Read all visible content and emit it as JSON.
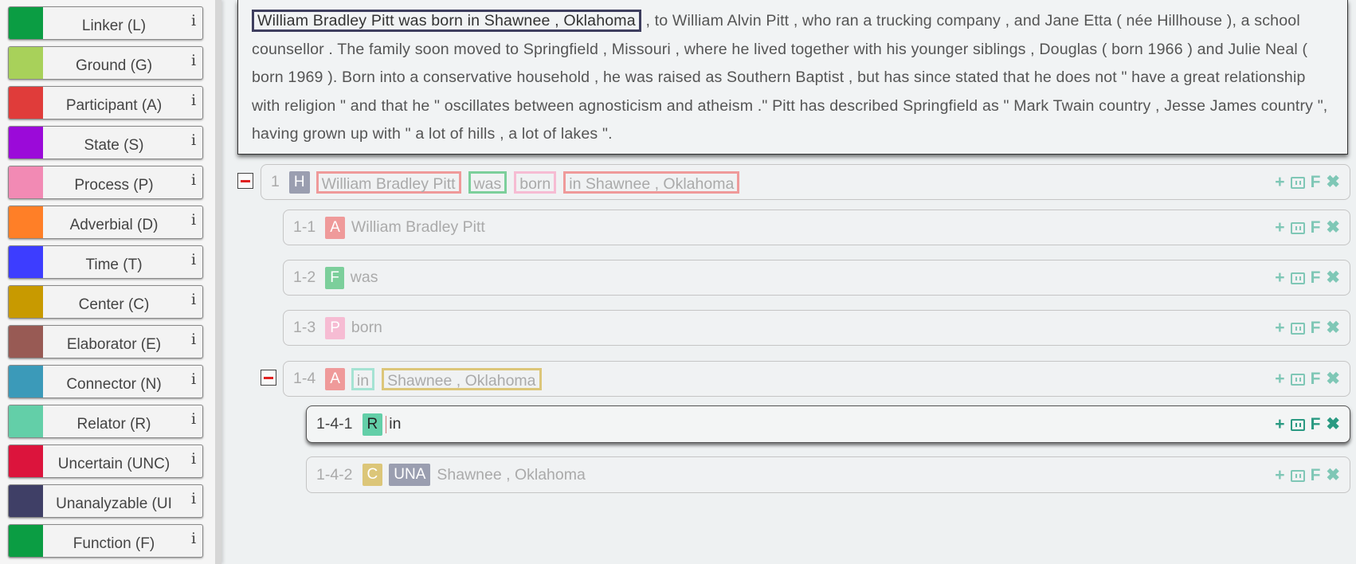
{
  "sidebar": {
    "categories": [
      {
        "label": "Linker (L)",
        "color": "#0b9d43",
        "info": "i"
      },
      {
        "label": "Ground (G)",
        "color": "#a8d15a",
        "info": "i"
      },
      {
        "label": "Participant (A)",
        "color": "#e03c3a",
        "info": "i"
      },
      {
        "label": "State (S)",
        "color": "#9b0ad9",
        "info": "i"
      },
      {
        "label": "Process (P)",
        "color": "#f28ab4",
        "info": "i"
      },
      {
        "label": "Adverbial (D)",
        "color": "#ff7f27",
        "info": "i"
      },
      {
        "label": "Time (T)",
        "color": "#3d3dff",
        "info": "i"
      },
      {
        "label": "Center (C)",
        "color": "#c89a00",
        "info": "i"
      },
      {
        "label": "Elaborator (E)",
        "color": "#985a54",
        "info": "i"
      },
      {
        "label": "Connector (N)",
        "color": "#3b9ab9",
        "info": "i"
      },
      {
        "label": "Relator (R)",
        "color": "#63cfa8",
        "info": "i"
      },
      {
        "label": "Uncertain (UNC)",
        "color": "#dc143c",
        "info": "i"
      },
      {
        "label": "Unanalyzable (UI",
        "color": "#3f3f66",
        "info": "i"
      },
      {
        "label": "Function (F)",
        "color": "#0b9d43",
        "info": "i"
      }
    ]
  },
  "passage": {
    "selected": "William Bradley Pitt was born in Shawnee , Oklahoma",
    "rest": " , to William Alvin Pitt , who ran a trucking company , and Jane Etta ( née Hillhouse ), a school counsellor . The family soon moved to Springfield , Missouri , where he lived together with his younger siblings , Douglas ( born 1966 ) and Julie Neal ( born 1969 ). Born into a conservative household , he was raised as Southern Baptist , but has since stated that he does not \" have a great relationship with religion \" and that he \" oscillates between agnosticism and atheism .\" Pitt has described Springfield as \" Mark Twain country , Jesse James country \", having grown up with \" a lot of hills , a lot of lakes \"."
  },
  "actions": {
    "add": "+",
    "function": "F",
    "remove": "✖"
  },
  "rows": {
    "r1": {
      "id": "1",
      "badge": "H",
      "badge_color": "#9a9eb0",
      "chips": [
        {
          "text": "William Bradley Pitt",
          "color": "#ef9a9a"
        },
        {
          "text": "was",
          "color": "#7ccf9b"
        },
        {
          "text": "born",
          "color": "#f6bcd3"
        },
        {
          "text": "in Shawnee , Oklahoma",
          "color": "#ef9a9a"
        }
      ]
    },
    "r11": {
      "id": "1-1",
      "badge": "A",
      "badge_color": "#ef9a9a",
      "text": "William Bradley Pitt"
    },
    "r12": {
      "id": "1-2",
      "badge": "F",
      "badge_color": "#7ccf9b",
      "text": "was"
    },
    "r13": {
      "id": "1-3",
      "badge": "P",
      "badge_color": "#f6bcd3",
      "text": "born"
    },
    "r14": {
      "id": "1-4",
      "badge": "A",
      "badge_color": "#ef9a9a",
      "chips": [
        {
          "text": "in",
          "color": "#a5e3d3"
        },
        {
          "text": "Shawnee , Oklahoma",
          "color": "#dcc679"
        }
      ]
    },
    "r141": {
      "id": "1-4-1",
      "badge": "R",
      "badge_color": "#63cfa8",
      "text": "in"
    },
    "r142": {
      "id": "1-4-2",
      "badge": "C",
      "badge_color": "#dcc679",
      "badge2": "UNA",
      "badge2_color": "#9a9eb0",
      "text": "Shawnee , Oklahoma"
    }
  }
}
